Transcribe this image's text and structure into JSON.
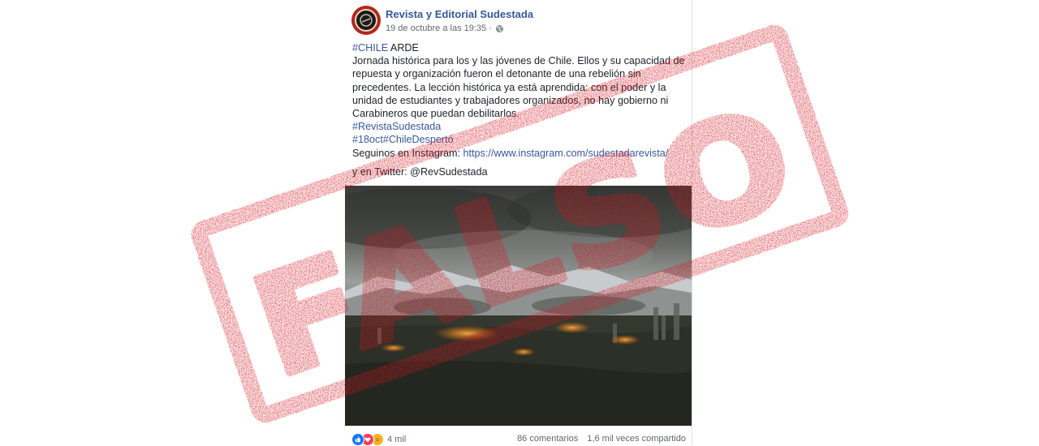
{
  "post": {
    "page_name": "Revista y Editorial Sudestada",
    "timestamp": "19 de octubre a las 19:35 ·",
    "privacy_icon": "globe-icon",
    "text": {
      "hashtag_1": "#CHILE",
      "line_1_rest": " ARDE",
      "line_2": "Jornada histórica para los y las jóvenes de Chile. Ellos y su capacidad de",
      "line_3": "repuesta y organización fueron el detonante de una rebelión sin",
      "line_4": "precedentes. La lección histórica ya está aprendida: con el poder y la",
      "line_5": "unidad de estudiantes y trabajadores organizados, no hay gobierno ni",
      "line_6": "Carabineros que puedan debilitarlos.",
      "hashtag_2": "#RevistaSudestada",
      "hashtag_3": "#18oct#ChileDespertó",
      "instagram_prefix": "Seguinos en Instagram: ",
      "instagram_link": "https://www.instagram.com/sudestadarevista/",
      "twitter_line": "y en Twitter: @RevSudestada"
    },
    "reactions": {
      "icons": [
        "like-icon",
        "love-icon",
        "sad-icon"
      ],
      "count": "4 mil"
    },
    "comments": "86 comentarios",
    "shares": "1,6 mil veces compartido"
  },
  "stamp": {
    "label": "FALSO",
    "color": "#d7141d"
  },
  "colors": {
    "link": "#385898",
    "text": "#1d2129",
    "meta": "#616770"
  }
}
